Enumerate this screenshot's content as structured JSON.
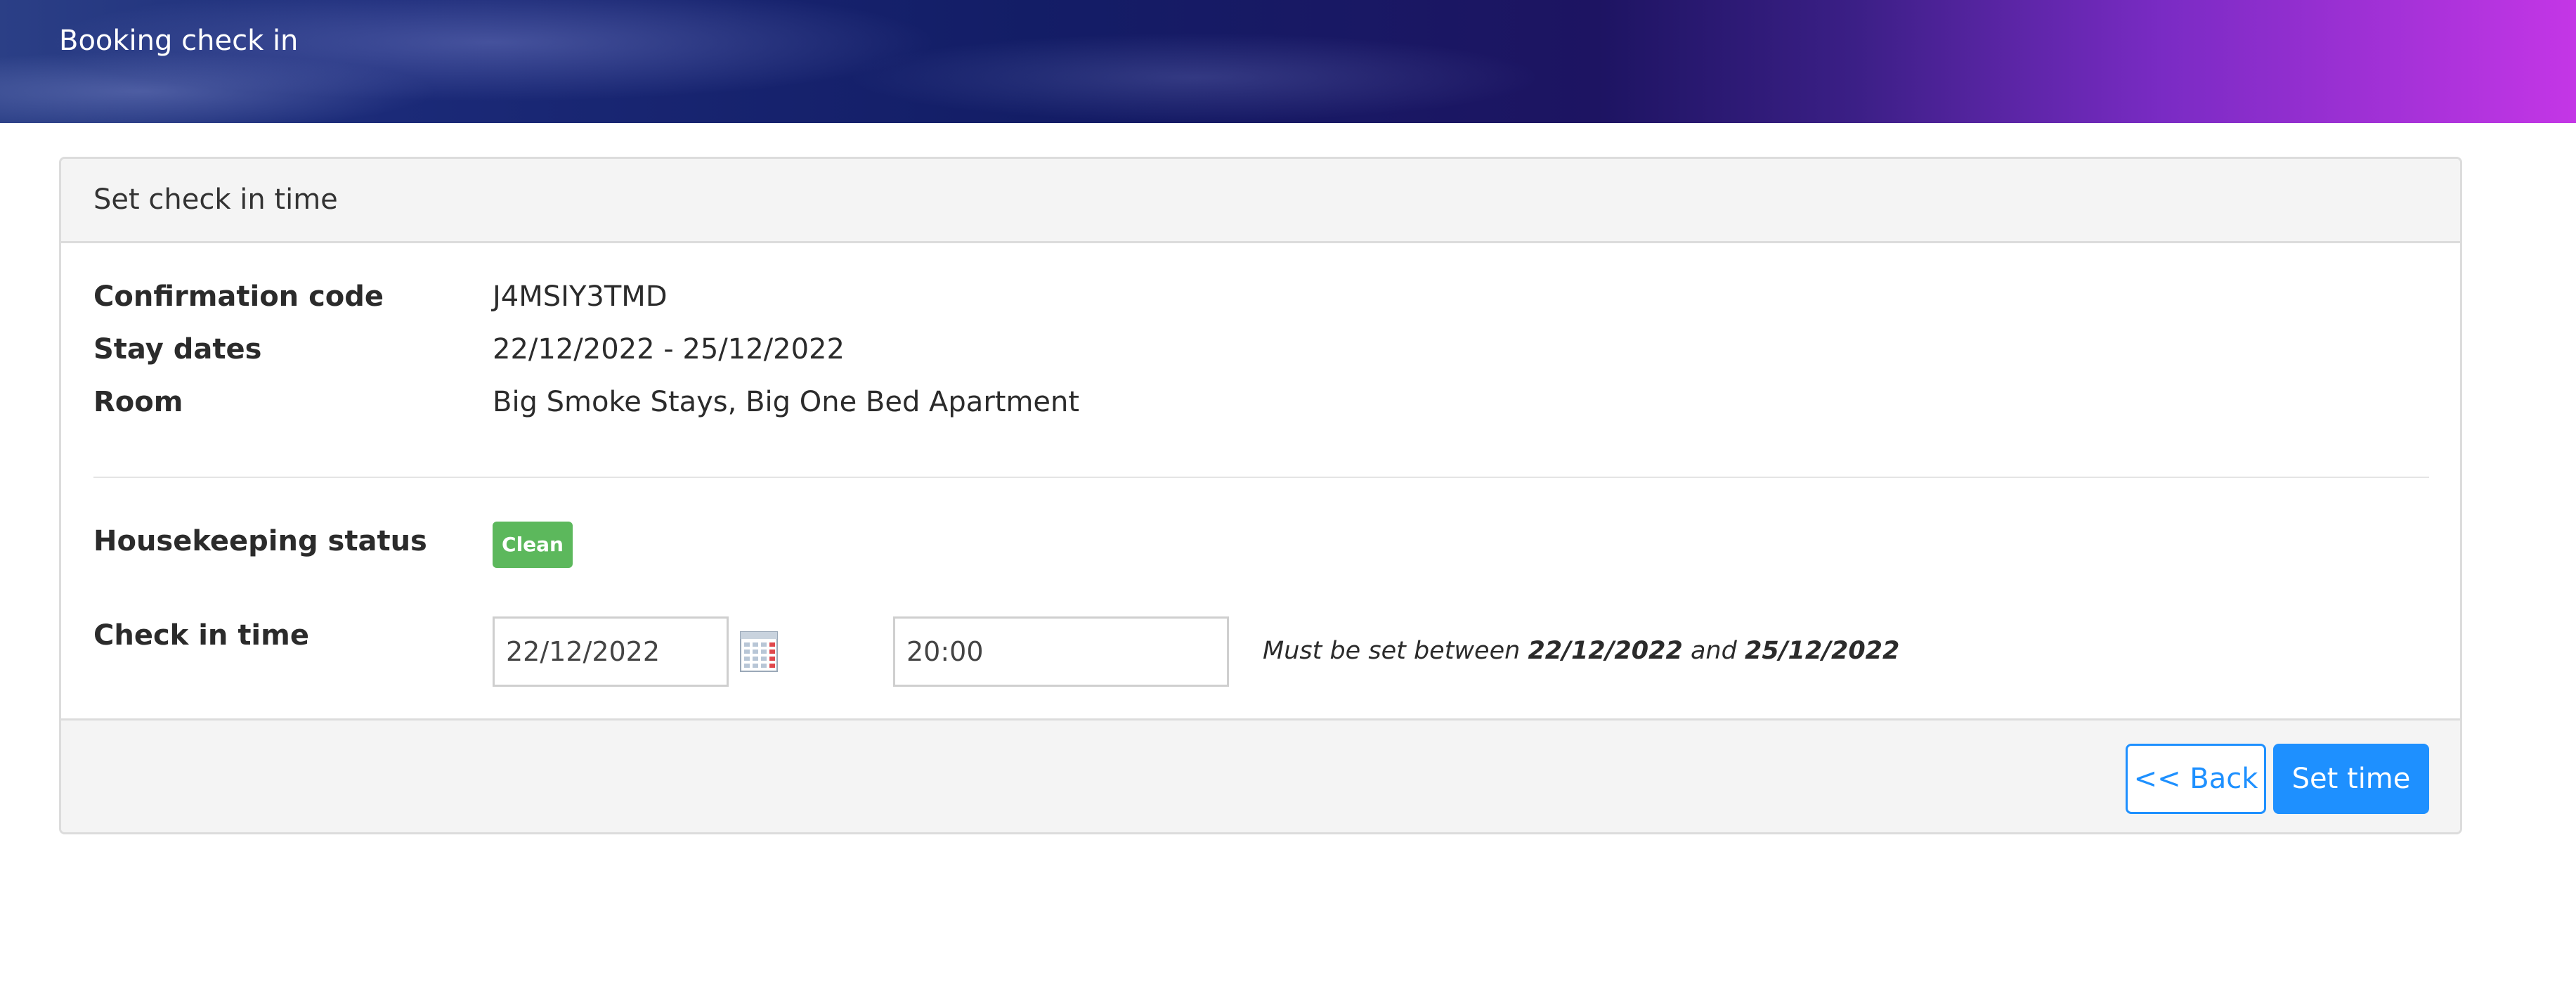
{
  "header": {
    "title": "Booking check in"
  },
  "panel": {
    "heading": "Set check in time",
    "details": [
      {
        "label": "Confirmation code",
        "value": "J4MSIY3TMD"
      },
      {
        "label": "Stay dates",
        "value": "22/12/2022 - 25/12/2022"
      },
      {
        "label": "Room",
        "value": "Big Smoke Stays, Big One Bed Apartment"
      }
    ],
    "housekeeping": {
      "label": "Housekeeping status",
      "badge": "Clean",
      "badge_color": "#5cb85c"
    },
    "checkin": {
      "label": "Check in time",
      "date_value": "22/12/2022",
      "time_value": "20:00",
      "calendar_icon": "calendar-icon",
      "hint_prefix": "Must be set between",
      "hint_start": "22/12/2022",
      "hint_and": "and",
      "hint_end": "25/12/2022"
    }
  },
  "footer": {
    "back_label": "<< Back",
    "set_label": "Set time",
    "accent_color": "#1e90ff"
  }
}
